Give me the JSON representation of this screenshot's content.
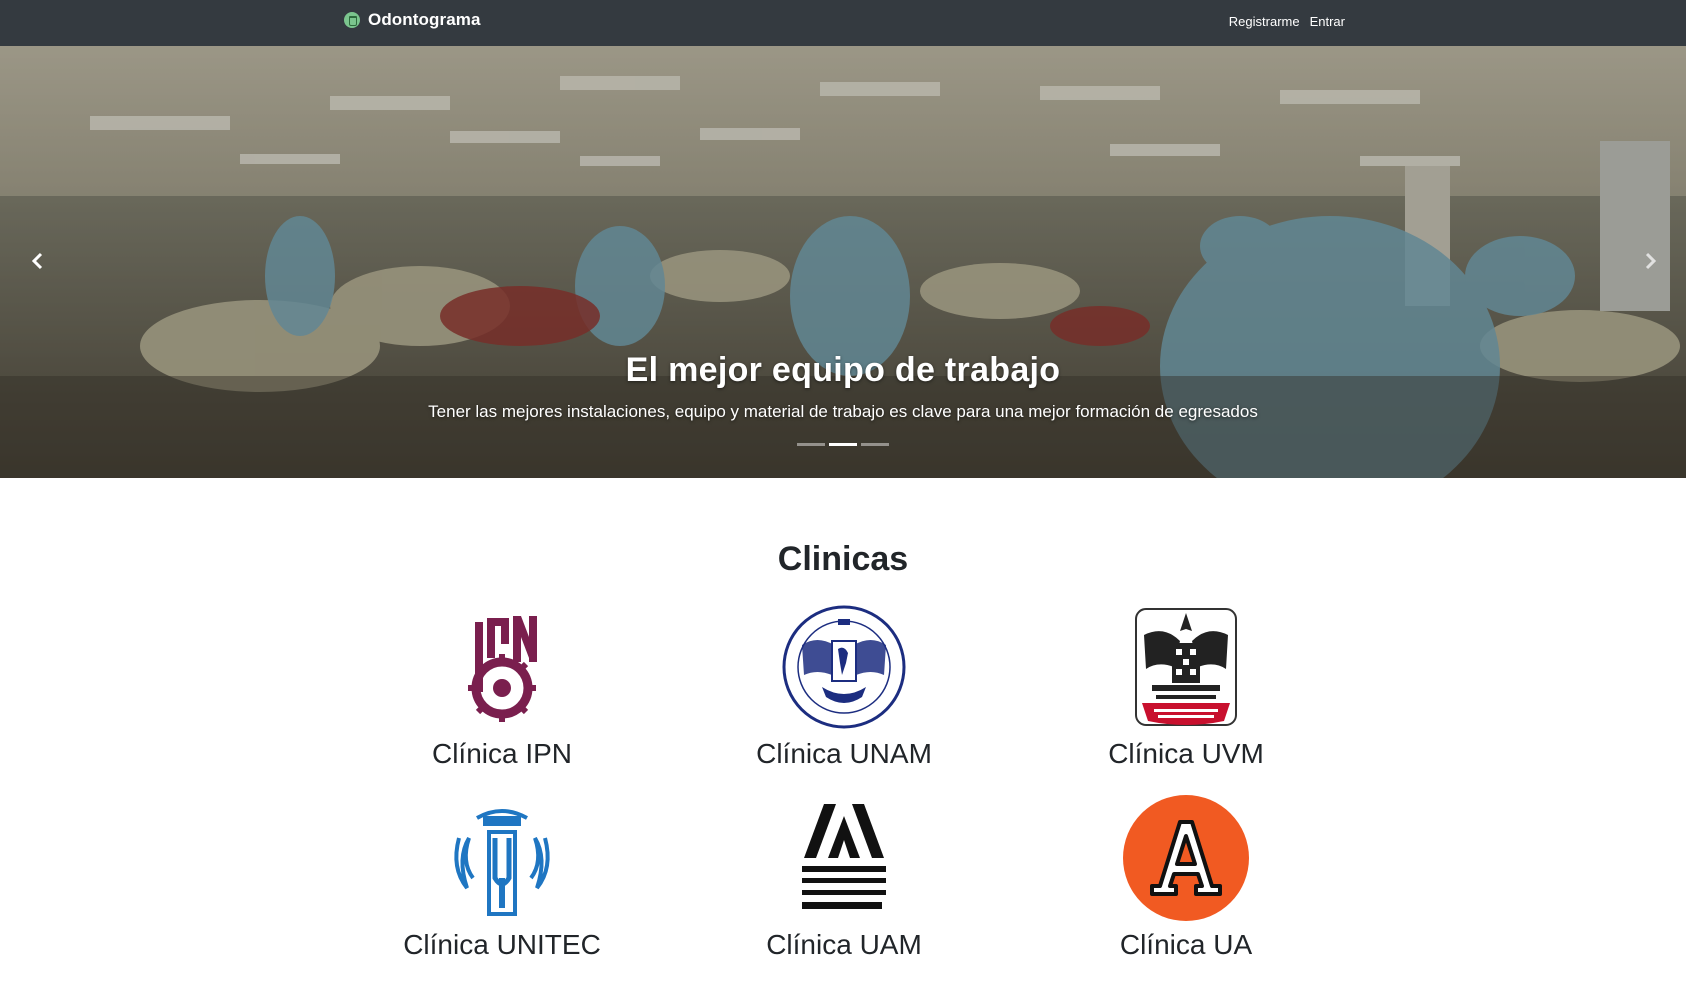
{
  "navbar": {
    "brand": "Odontograma",
    "links": [
      "Registrarme",
      "Entrar"
    ]
  },
  "carousel": {
    "title": "El mejor equipo de trabajo",
    "text": "Tener las mejores instalaciones, equipo y material de trabajo es clave para una mejor formación de egresados",
    "slide_count": 3,
    "active_slide": 2
  },
  "clinics": {
    "title": "Clinicas",
    "items": [
      {
        "name": "Clínica IPN",
        "logo": "ipn-logo-icon",
        "color": "#7a1f4e"
      },
      {
        "name": "Clínica UNAM",
        "logo": "unam-logo-icon",
        "color": "#1c2d80"
      },
      {
        "name": "Clínica UVM",
        "logo": "uvm-logo-icon",
        "color": "#c8102e"
      },
      {
        "name": "Clínica UNITEC",
        "logo": "unitec-logo-icon",
        "color": "#1f76c2"
      },
      {
        "name": "Clínica UAM",
        "logo": "uam-logo-icon",
        "color": "#111111"
      },
      {
        "name": "Clínica UA",
        "logo": "ua-logo-icon",
        "color": "#f15a22"
      }
    ]
  }
}
